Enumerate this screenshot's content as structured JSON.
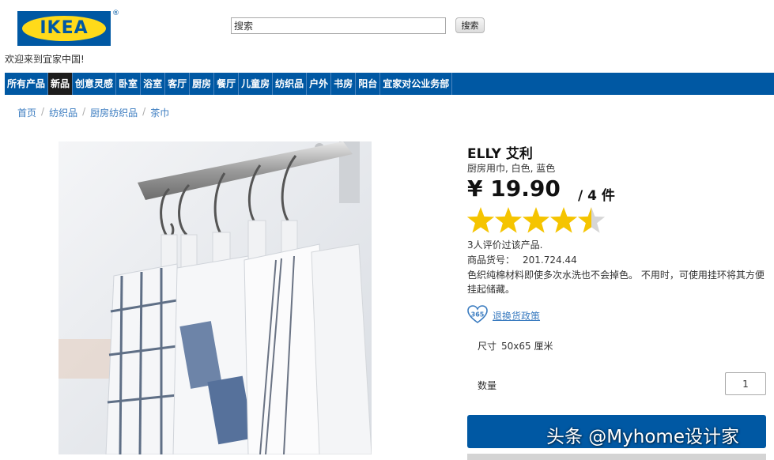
{
  "logo": {
    "text": "IKEA",
    "registered": "®"
  },
  "welcome": "欢迎来到宜家中国!",
  "search": {
    "placeholder": "搜索",
    "button": "搜索"
  },
  "nav": {
    "items": [
      {
        "label": "所有产品"
      },
      {
        "label": "新品"
      },
      {
        "label": "创意灵感"
      },
      {
        "label": "卧室"
      },
      {
        "label": "浴室"
      },
      {
        "label": "客厅"
      },
      {
        "label": "厨房"
      },
      {
        "label": "餐厅"
      },
      {
        "label": "儿童房"
      },
      {
        "label": "纺织品"
      },
      {
        "label": "户外"
      },
      {
        "label": "书房"
      },
      {
        "label": "阳台"
      },
      {
        "label": "宜家对公业务部"
      }
    ],
    "active_index": 1
  },
  "breadcrumb": {
    "items": [
      {
        "label": "首页"
      },
      {
        "label": "纺织品"
      },
      {
        "label": "厨房纺织品"
      },
      {
        "label": "茶巾"
      }
    ],
    "separator": "/"
  },
  "product": {
    "title": "ELLY 艾利",
    "subtitle": "厨房用巾, 白色, 蓝色",
    "price": "¥ 19.90",
    "unit": "/ 4 件",
    "rating": 4.5,
    "rating_max": 5,
    "reviews": "3人评价过该产品.",
    "article_label": "商品货号：",
    "article_number": "201.724.44",
    "description": "色织纯棉材料即使多次水洗也不会掉色。 不用时，可使用挂环将其方便挂起储藏。",
    "return_badge": "365",
    "return_policy": "退换货政策",
    "size_label": "尺寸",
    "size_value": "50x65 厘米",
    "quantity_label": "数量",
    "quantity": "1"
  },
  "watermark": "头条 @Myhome设计家",
  "colors": {
    "brand_blue": "#0058a3",
    "brand_yellow": "#ffda1a",
    "star": "#f5c400",
    "link": "#3b7cc0"
  },
  "icons": {
    "return": "heart-365-icon",
    "rating": "star-icon"
  }
}
